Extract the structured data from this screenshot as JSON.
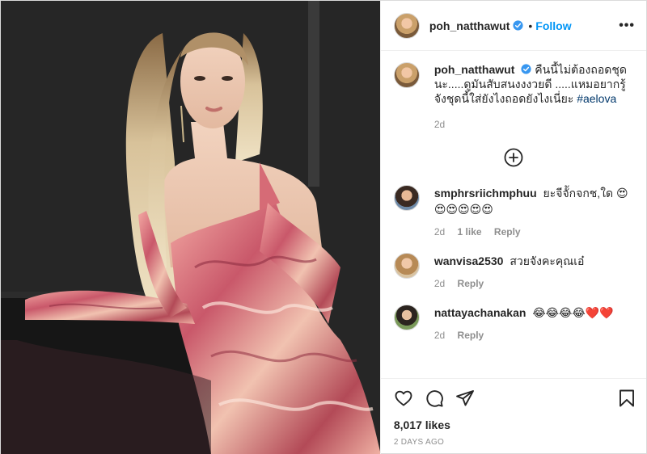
{
  "header": {
    "username": "poh_natthawut",
    "separator": "•",
    "follow_label": "Follow",
    "more_label": "•••",
    "verified_icon": "verified-badge-icon"
  },
  "caption": {
    "username": "poh_natthawut",
    "text": "คืนนี้ไม่ต้องถอดชุดนะ.....ดูมันสับสนงงงวยดี .....แหมอยากรู้จังชุดนี้ใส่ยังไงถอดยังไงเนี่ยะ",
    "hashtag": "#aelova",
    "time": "2d"
  },
  "load_more_icon": "plus-circle-icon",
  "comments": [
    {
      "username": "smphrsriichmphuu",
      "text": "ยะจีจัักจกช,ใด 😍😍😍😍😍😍",
      "time": "2d",
      "likes": "1 like",
      "reply": "Reply"
    },
    {
      "username": "wanvisa2530",
      "text": "สวยจังคะคุณเอ๋",
      "time": "2d",
      "reply": "Reply"
    },
    {
      "username": "nattayachanakan",
      "text": "😂😂😂😂❤️❤️",
      "time": "2d",
      "reply": "Reply"
    }
  ],
  "actions": {
    "icons": [
      "heart-icon",
      "comment-icon",
      "share-icon",
      "bookmark-icon"
    ]
  },
  "likes_label": "8,017 likes",
  "date_label": "2 DAYS AGO",
  "colors": {
    "accent": "#0095f6",
    "hashtag": "#00376b",
    "muted": "#8e8e8e",
    "text": "#262626"
  }
}
